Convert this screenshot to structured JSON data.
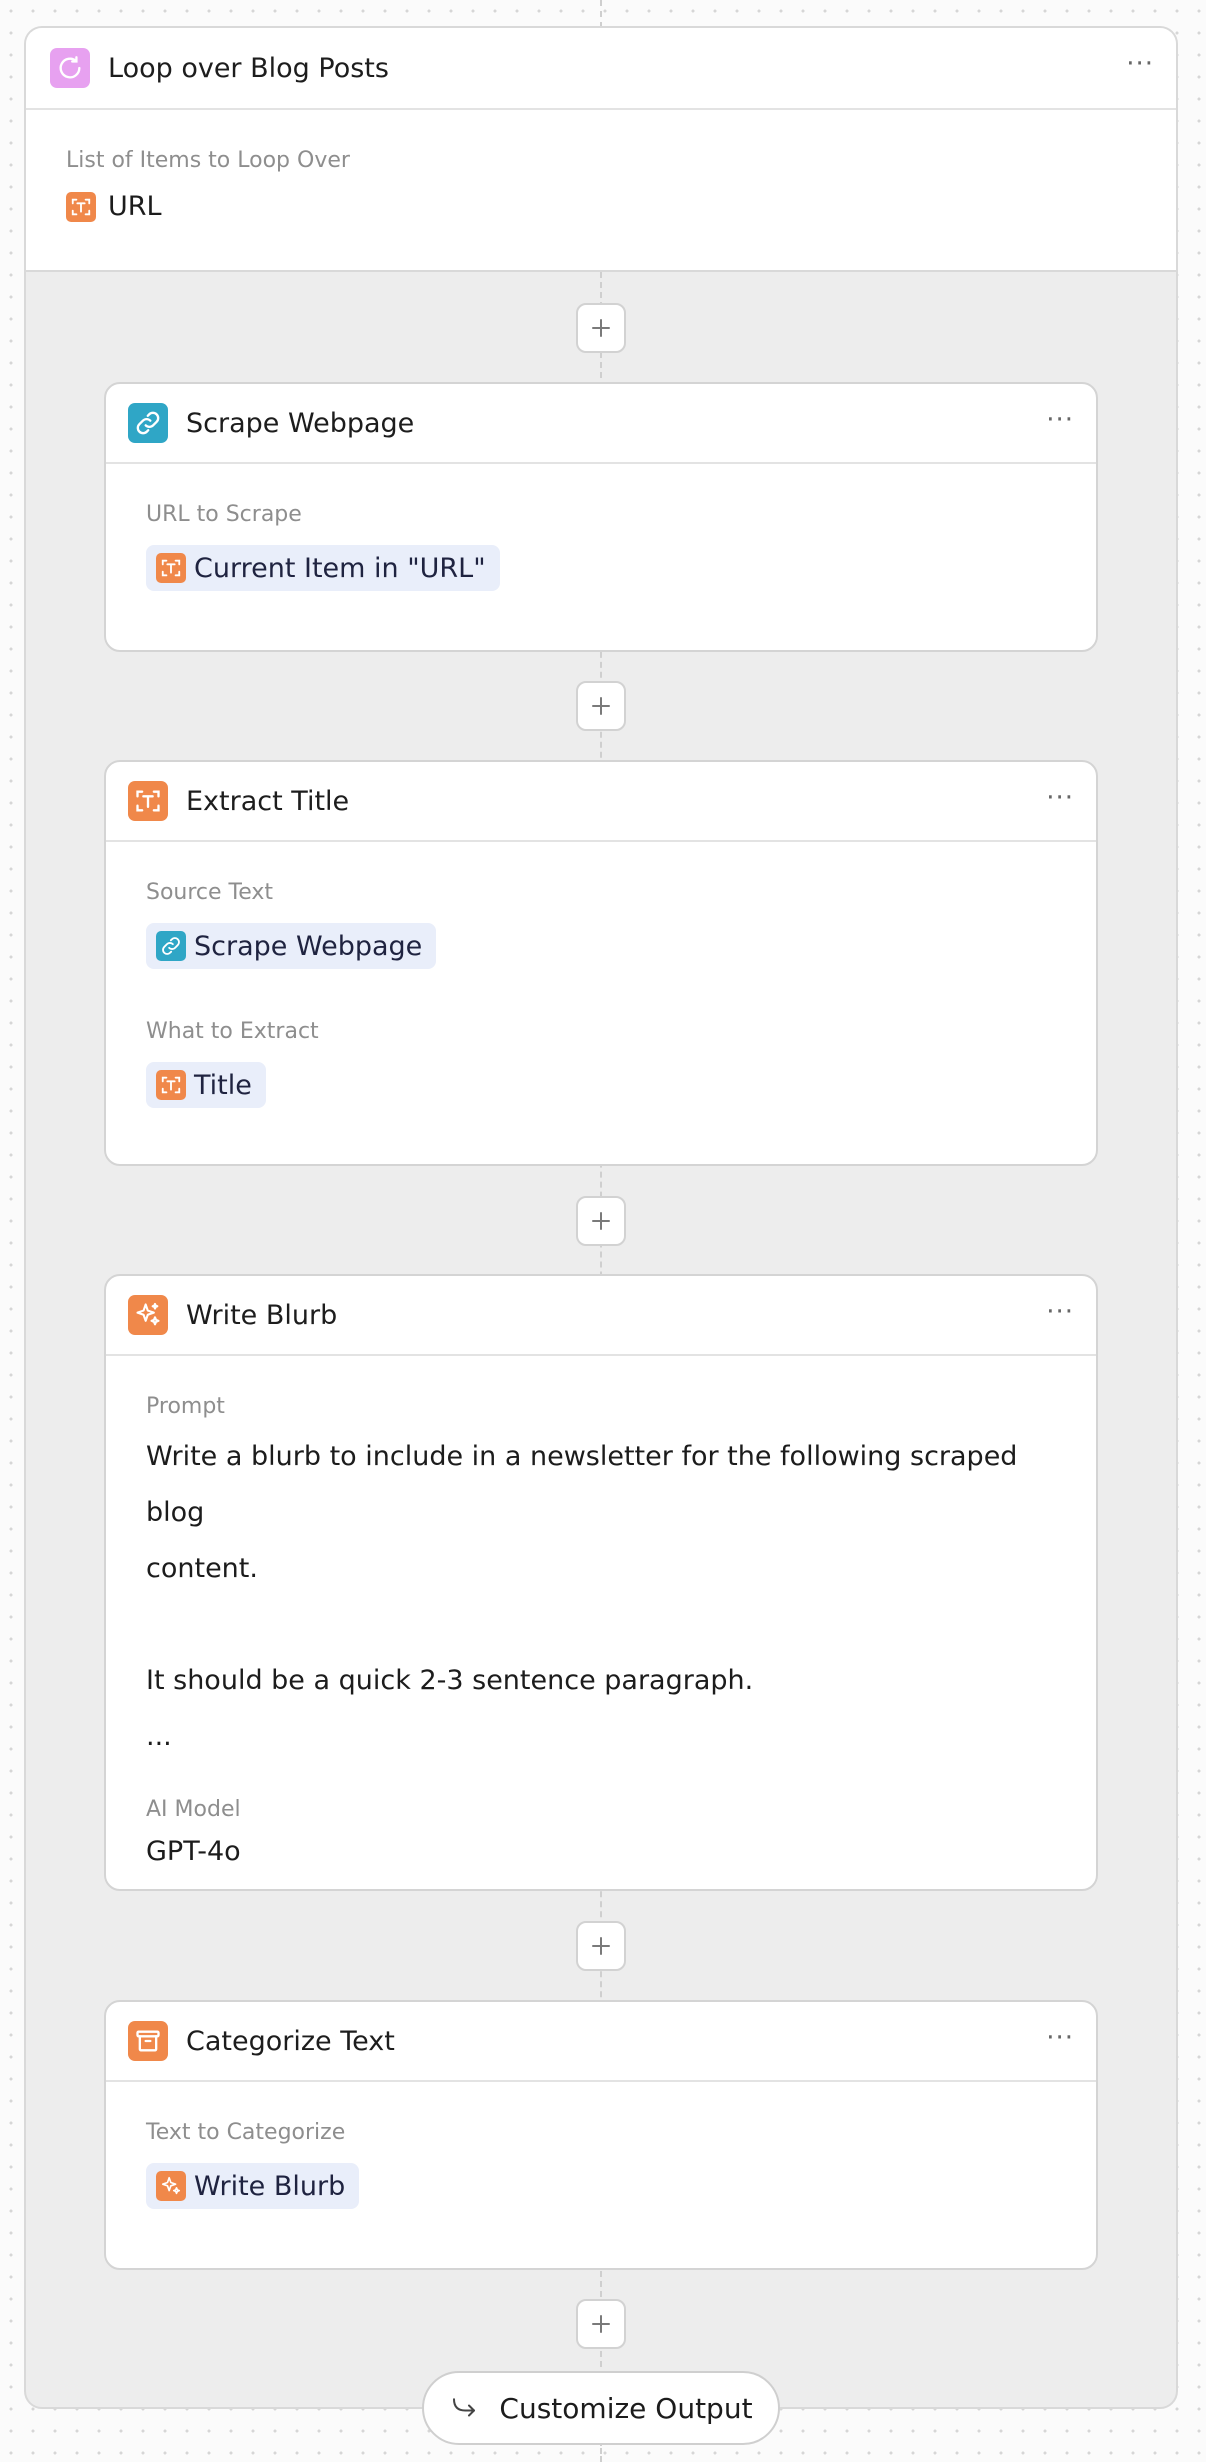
{
  "loop": {
    "title": "Loop over Blog Posts",
    "icon": "loop-icon",
    "field_label": "List of Items to Loop Over",
    "field_value": "URL",
    "field_icon": "text-extract-icon",
    "more_label": "···"
  },
  "steps": [
    {
      "title": "Scrape Webpage",
      "icon": "link-icon",
      "fields": [
        {
          "label": "URL to Scrape",
          "chip": "Current Item in \"URL\"",
          "chip_icon": "text-extract-icon"
        }
      ]
    },
    {
      "title": "Extract Title",
      "icon": "text-extract-icon",
      "fields": [
        {
          "label": "Source Text",
          "chip": "Scrape Webpage",
          "chip_icon": "link-icon"
        },
        {
          "label": "What to Extract",
          "chip": "Title",
          "chip_icon": "text-extract-icon"
        }
      ]
    },
    {
      "title": "Write Blurb",
      "icon": "sparkle-icon",
      "prompt_label": "Prompt",
      "prompt_lines": [
        "Write a blurb to include in a newsletter for the following scraped blog",
        "content.",
        "",
        "It should be a quick 2-3 sentence paragraph.",
        "..."
      ],
      "model_label": "AI Model",
      "model_value": "GPT-4o"
    },
    {
      "title": "Categorize Text",
      "icon": "archive-icon",
      "fields": [
        {
          "label": "Text to Categorize",
          "chip": "Write Blurb",
          "chip_icon": "sparkle-icon"
        }
      ]
    }
  ],
  "customize_output_label": "Customize Output",
  "colors": {
    "loop_icon_bg": "#e7a1f0",
    "link_icon_bg": "#2fa6c6",
    "orange_icon_bg": "#f0884a",
    "chip_bg": "#e9eefa",
    "loop_region_bg": "#ededed"
  }
}
